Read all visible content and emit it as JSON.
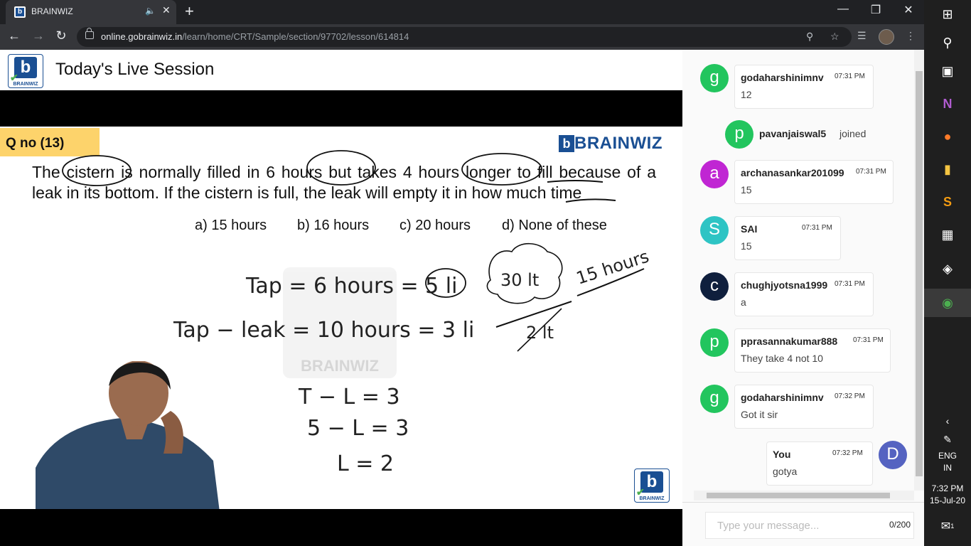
{
  "browser": {
    "tab_title": "BRAINWIZ",
    "url_host": "online.gobrainwiz.in",
    "url_path": "/learn/home/CRT/Sample/section/97702/lesson/614814"
  },
  "header": {
    "logo_text": "BRAINWIZ",
    "title": "Today's Live Session"
  },
  "slide": {
    "qno": "Q no (13)",
    "brand": "BRAINWIZ",
    "question": "The cistern is normally filled in 6 hours but takes 4 hours longer to fill because of a leak in its bottom. If the cistern is full, the leak will empty it in how much time",
    "options": [
      "a) 15 hours",
      "b)  16 hours",
      "c) 20 hours",
      "d) None  of these"
    ],
    "handwriting": {
      "line1": "Tap = 6 hours = 5 li",
      "line2": "Tap − leak = 10 hours = 3 li",
      "cloud": "30 lt",
      "fraction_den": "2 lt",
      "answer": "15 hours",
      "eq1": "T − L = 3",
      "eq2": "5 − L = 3",
      "eq3": "L = 2"
    },
    "watermark": "BRAINWIZ"
  },
  "chat": {
    "messages": [
      {
        "avatar": "g",
        "color": "#22c55e",
        "sender": "godaharshinimnv",
        "time": "07:31 PM",
        "text": "12"
      },
      {
        "avatar": "a",
        "color": "#c026d3",
        "sender": "archanasankar201099",
        "time": "07:31 PM",
        "text": "15"
      },
      {
        "avatar": "S",
        "color": "#2ec4c4",
        "sender": "SAI",
        "time": "07:31 PM",
        "text": "15"
      },
      {
        "avatar": "c",
        "color": "#0f1f3d",
        "sender": "chughjyotsna1999",
        "time": "07:31 PM",
        "text": "a"
      },
      {
        "avatar": "p",
        "color": "#22c55e",
        "sender": "pprasannakumar888",
        "time": "07:31 PM",
        "text": "They take 4 not 10"
      },
      {
        "avatar": "g",
        "color": "#22c55e",
        "sender": "godaharshinimnv",
        "time": "07:32 PM",
        "text": "Got it sir"
      }
    ],
    "join": {
      "avatar": "p",
      "color": "#22c55e",
      "user": "pavanjaiswal5",
      "action": "joined"
    },
    "self": {
      "avatar": "D",
      "color": "#5563c1",
      "sender": "You",
      "time": "07:32 PM",
      "text": "gotya"
    },
    "input_placeholder": "Type your message...",
    "counter": "0/200"
  },
  "taskbar": {
    "lang1": "ENG",
    "lang2": "IN",
    "time": "7:32 PM",
    "date": "15-Jul-20",
    "notif_count": "1"
  }
}
